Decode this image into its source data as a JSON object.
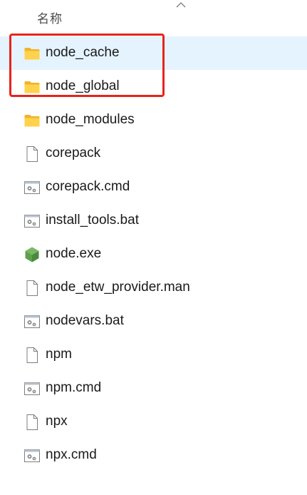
{
  "header": {
    "column_name": "名称"
  },
  "files": [
    {
      "name": "node_cache",
      "icon": "folder-icon",
      "selected": true
    },
    {
      "name": "node_global",
      "icon": "folder-icon",
      "selected": false
    },
    {
      "name": "node_modules",
      "icon": "folder-icon",
      "selected": false
    },
    {
      "name": "corepack",
      "icon": "file-icon",
      "selected": false
    },
    {
      "name": "corepack.cmd",
      "icon": "script-file-icon",
      "selected": false
    },
    {
      "name": "install_tools.bat",
      "icon": "script-file-icon",
      "selected": false
    },
    {
      "name": "node.exe",
      "icon": "nodejs-icon",
      "selected": false
    },
    {
      "name": "node_etw_provider.man",
      "icon": "file-icon",
      "selected": false
    },
    {
      "name": "nodevars.bat",
      "icon": "script-file-icon",
      "selected": false
    },
    {
      "name": "npm",
      "icon": "file-icon",
      "selected": false
    },
    {
      "name": "npm.cmd",
      "icon": "script-file-icon",
      "selected": false
    },
    {
      "name": "npx",
      "icon": "file-icon",
      "selected": false
    },
    {
      "name": "npx.cmd",
      "icon": "script-file-icon",
      "selected": false
    }
  ],
  "colors": {
    "selected_row": "#e5f3ff",
    "annotation_border": "#e8231b",
    "folder": "#ffca28"
  }
}
